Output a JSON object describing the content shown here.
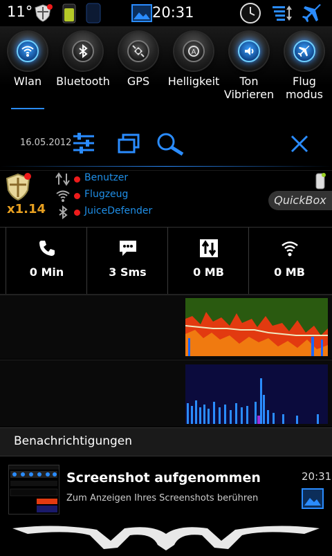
{
  "status_bar": {
    "temperature": "11°",
    "time": "20:31",
    "icons": [
      "shield-icon",
      "battery-icon",
      "phone-icon",
      "image-icon",
      "clock-icon",
      "sync-icon",
      "airplane-icon"
    ]
  },
  "toggles": [
    {
      "label": "Wlan",
      "icon": "wifi-icon",
      "active": true
    },
    {
      "label": "Bluetooth",
      "icon": "bluetooth-icon",
      "active": false
    },
    {
      "label": "GPS",
      "icon": "gps-icon",
      "active": false
    },
    {
      "label": "Helligkeit",
      "icon": "brightness-icon",
      "active": false
    },
    {
      "label": "Ton Vibrieren",
      "icon": "sound-icon",
      "active": true
    },
    {
      "label": "Flug modus",
      "icon": "airplane-icon",
      "active": true
    }
  ],
  "controls": {
    "date": "16.05.2012",
    "icons": [
      "settings-sliders-icon",
      "windows-icon",
      "search-icon",
      "close-icon"
    ]
  },
  "info": {
    "multiplier": "x1.14",
    "rows": [
      {
        "label": "Benutzer",
        "icon": "data-arrows-icon"
      },
      {
        "label": "Flugzeug",
        "icon": "wifi-small-icon"
      },
      {
        "label": "JuiceDefender",
        "icon": "bluetooth-small-icon"
      }
    ],
    "quickbox_label": "QuickBox"
  },
  "stats": [
    {
      "value": "0 Min",
      "icon": "phone-call-icon"
    },
    {
      "value": "3 Sms",
      "icon": "sms-icon"
    },
    {
      "value": "0 MB",
      "icon": "mobile-data-icon"
    },
    {
      "value": "0 MB",
      "icon": "wifi-data-icon"
    }
  ],
  "notifications": {
    "header": "Benachrichtigungen",
    "items": [
      {
        "title": "Screenshot aufgenommen",
        "subtitle": "Zum Anzeigen Ihres Screenshots berühren",
        "time": "20:31"
      }
    ]
  },
  "colors": {
    "accent_blue": "#1f8fe8",
    "alert_red": "#ee1b1b",
    "multiplier_orange": "#e8a020"
  }
}
